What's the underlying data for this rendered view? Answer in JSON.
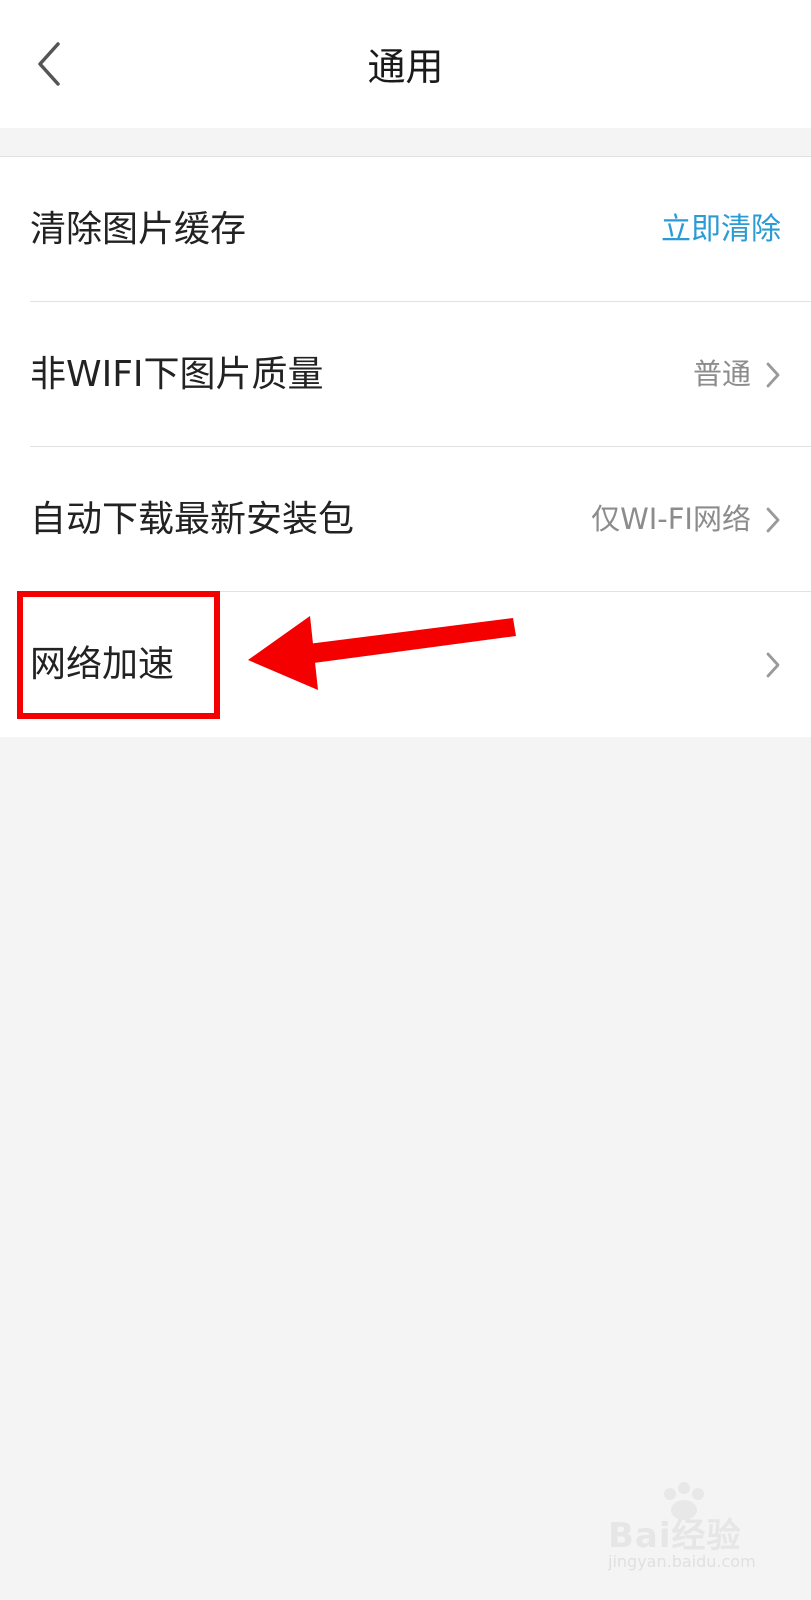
{
  "header": {
    "title": "通用",
    "back_icon": "chevron-left-icon"
  },
  "settings": [
    {
      "label": "清除图片缓存",
      "action": "立即清除",
      "action_color": "#2b9bd6"
    },
    {
      "label": "非WIFI下图片质量",
      "value": "普通",
      "icon": "chevron-right-icon"
    },
    {
      "label": "自动下载最新安装包",
      "value": "仅WI-FI网络",
      "icon": "chevron-right-icon"
    },
    {
      "label": "网络加速",
      "icon": "chevron-right-icon"
    }
  ],
  "annotation": {
    "color": "#f40000",
    "highlight_target": "网络加速"
  },
  "watermark": {
    "brand": "Bai经验",
    "sub": "jingyan.baidu.com"
  }
}
